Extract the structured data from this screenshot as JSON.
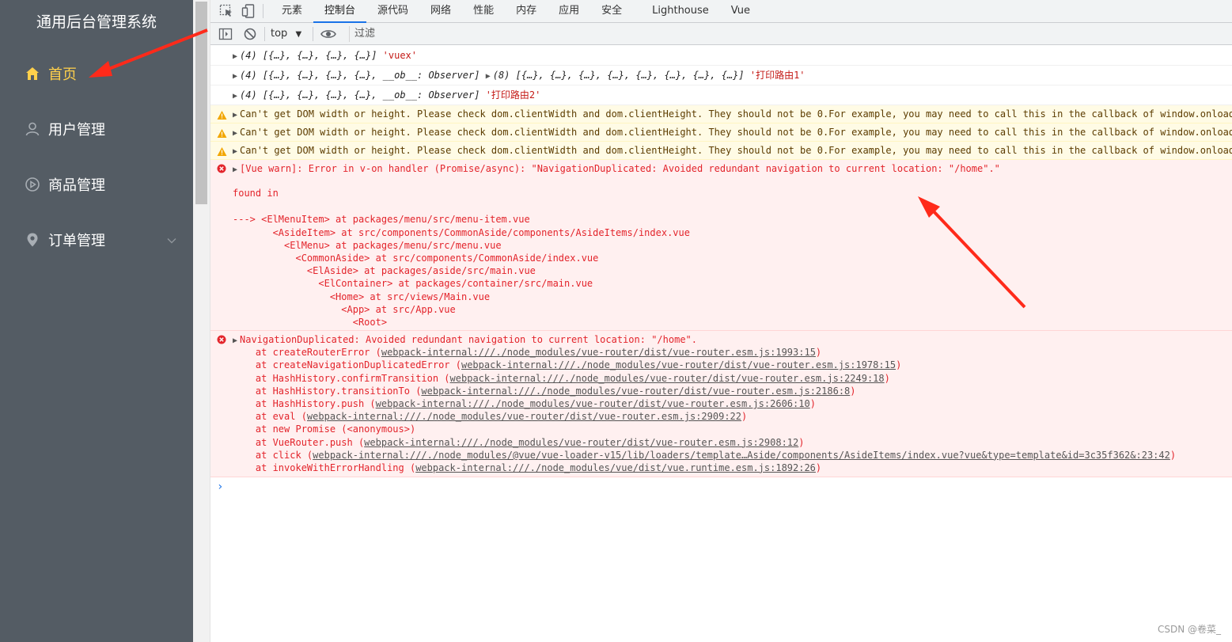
{
  "sidebar": {
    "title": "通用后台管理系统",
    "items": [
      {
        "label": "首页",
        "icon": "home-icon"
      },
      {
        "label": "用户管理",
        "icon": "user-icon"
      },
      {
        "label": "商品管理",
        "icon": "video-play-icon"
      },
      {
        "label": "订单管理",
        "icon": "location-icon"
      }
    ],
    "colors": {
      "bg": "#545c64",
      "active": "#ffd04b",
      "text": "#ffffff"
    }
  },
  "devtools": {
    "tabs": [
      "元素",
      "控制台",
      "源代码",
      "网络",
      "性能",
      "内存",
      "应用",
      "安全",
      "Lighthouse",
      "Vue"
    ],
    "active_tab": "控制台",
    "context": "top",
    "filter_placeholder": "过滤"
  },
  "console": {
    "logs": [
      {
        "text": "(4) [{…}, {…}, {…}, {…}]",
        "label": "'vuex'"
      },
      {
        "text": "(4) [{…}, {…}, {…}, {…}, __ob__: Observer]",
        "text2": "(8) [{…}, {…}, {…}, {…}, {…}, {…}, {…}, {…}]",
        "label": "'打印路由1'"
      },
      {
        "text": "(4) [{…}, {…}, {…}, {…}, __ob__: Observer]",
        "label": "'打印路由2'"
      }
    ],
    "warnings": [
      "Can't get DOM width or height. Please check dom.clientWidth and dom.clientHeight. They should not be 0.For example, you may need to call this in the callback of window.onload.",
      "Can't get DOM width or height. Please check dom.clientWidth and dom.clientHeight. They should not be 0.For example, you may need to call this in the callback of window.onload.",
      "Can't get DOM width or height. Please check dom.clientWidth and dom.clientHeight. They should not be 0.For example, you may need to call this in the callback of window.onload."
    ],
    "vue_warn": {
      "message": "[Vue warn]: Error in v-on handler (Promise/async): \"NavigationDuplicated: Avoided redundant navigation to current location: \"/home\".\"",
      "found_in": "found in",
      "trace": [
        "---> <ElMenuItem> at packages/menu/src/menu-item.vue",
        "       <AsideItem> at src/components/CommonAside/components/AsideItems/index.vue",
        "         <ElMenu> at packages/menu/src/menu.vue",
        "           <CommonAside> at src/components/CommonAside/index.vue",
        "             <ElAside> at packages/aside/src/main.vue",
        "               <ElContainer> at packages/container/src/main.vue",
        "                 <Home> at src/views/Main.vue",
        "                   <App> at src/App.vue",
        "                     <Root>"
      ]
    },
    "nav_error": {
      "message": "NavigationDuplicated: Avoided redundant navigation to current location: \"/home\".",
      "stack": [
        {
          "fn": "    at createRouterError (",
          "link": "webpack-internal:///./node_modules/vue-router/dist/vue-router.esm.js:1993:15",
          "end": ")"
        },
        {
          "fn": "    at createNavigationDuplicatedError (",
          "link": "webpack-internal:///./node_modules/vue-router/dist/vue-router.esm.js:1978:15",
          "end": ")"
        },
        {
          "fn": "    at HashHistory.confirmTransition (",
          "link": "webpack-internal:///./node_modules/vue-router/dist/vue-router.esm.js:2249:18",
          "end": ")"
        },
        {
          "fn": "    at HashHistory.transitionTo (",
          "link": "webpack-internal:///./node_modules/vue-router/dist/vue-router.esm.js:2186:8",
          "end": ")"
        },
        {
          "fn": "    at HashHistory.push (",
          "link": "webpack-internal:///./node_modules/vue-router/dist/vue-router.esm.js:2606:10",
          "end": ")"
        },
        {
          "fn": "    at eval (",
          "link": "webpack-internal:///./node_modules/vue-router/dist/vue-router.esm.js:2909:22",
          "end": ")"
        },
        {
          "fn": "    at new Promise (<anonymous>)",
          "link": "",
          "end": ""
        },
        {
          "fn": "    at VueRouter.push (",
          "link": "webpack-internal:///./node_modules/vue-router/dist/vue-router.esm.js:2908:12",
          "end": ")"
        },
        {
          "fn": "    at click (",
          "link": "webpack-internal:///./node_modules/@vue/vue-loader-v15/lib/loaders/template…Aside/components/AsideItems/index.vue?vue&type=template&id=3c35f362&:23:42",
          "end": ")"
        },
        {
          "fn": "    at invokeWithErrorHandling (",
          "link": "webpack-internal:///./node_modules/vue/dist/vue.runtime.esm.js:1892:26",
          "end": ")"
        }
      ]
    },
    "prompt": "›"
  },
  "watermark": "CSDN @卷菜_",
  "colors": {
    "annotation_arrow": "#ff2a1a",
    "error_text": "#e3242b",
    "warn_bg": "#fffbe5",
    "error_bg": "#fff0f0"
  }
}
